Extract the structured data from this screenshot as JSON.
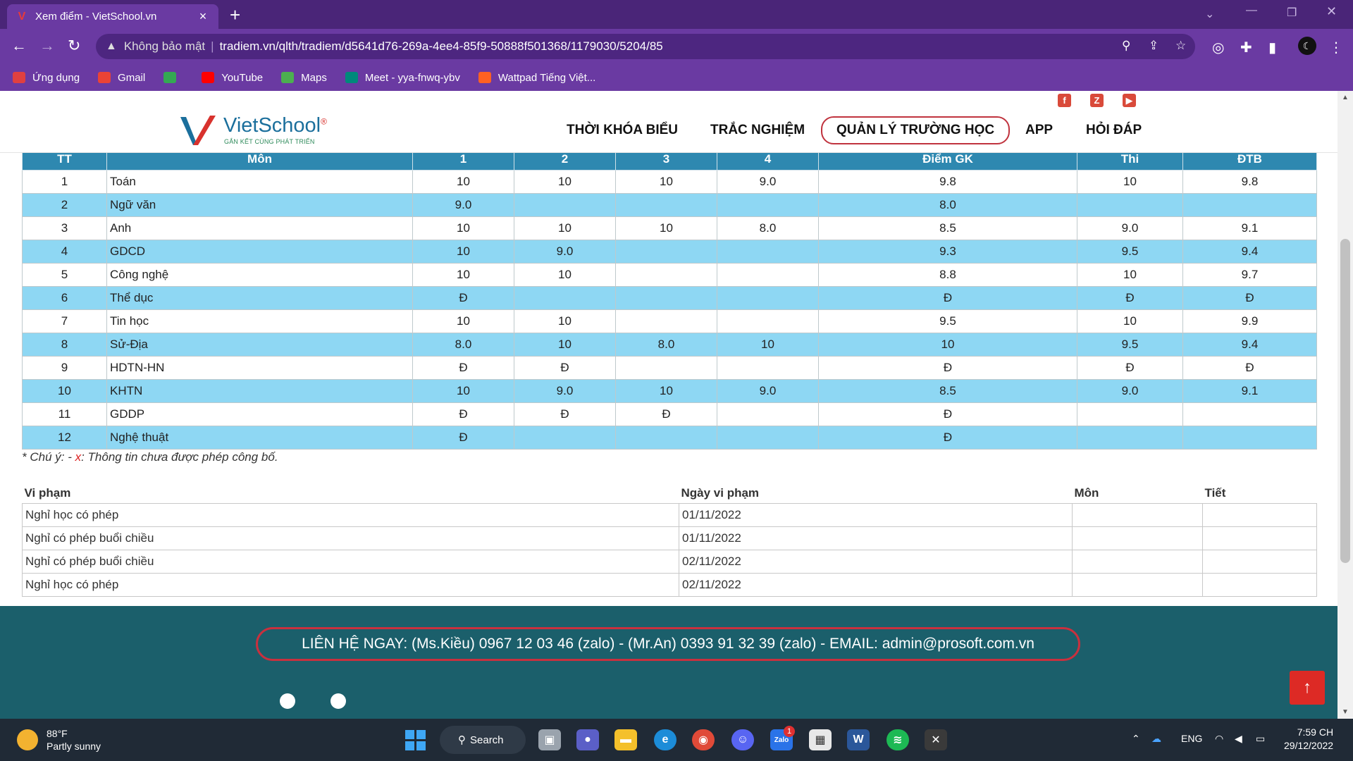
{
  "browser": {
    "tab_title": "Xem điểm - VietSchool.vn",
    "security_label": "Không bảo mật",
    "url": "tradiem.vn/qlth/tradiem/d5641d76-269a-4ee4-85f9-50888f501368/1179030/5204/85",
    "bookmarks": [
      {
        "label": "Ứng dụng",
        "color": "#e04040"
      },
      {
        "label": "Gmail",
        "color": "#ea4335"
      },
      {
        "label": "",
        "color": "#34a853"
      },
      {
        "label": "YouTube",
        "color": "#ff0000"
      },
      {
        "label": "Maps",
        "color": "#4caf50"
      },
      {
        "label": "Meet - yya-fnwq-ybv",
        "color": "#00897b"
      },
      {
        "label": "Wattpad Tiếng Việt...",
        "color": "#ff6122"
      }
    ]
  },
  "header": {
    "logo_text": "VietSchool",
    "logo_mark": "®",
    "logo_tagline": "GẮN KẾT CÙNG PHÁT TRIỂN",
    "menu": [
      {
        "label": "THỜI KHÓA BIỂU"
      },
      {
        "label": "TRẮC NGHIỆM"
      },
      {
        "label": "QUẢN LÝ TRƯỜNG HỌC"
      },
      {
        "label": "APP"
      },
      {
        "label": "HỎI ĐÁP"
      }
    ]
  },
  "grades": {
    "columns": [
      "TT",
      "Môn",
      "1",
      "2",
      "3",
      "4",
      "Điểm GK",
      "Thi",
      "ĐTB"
    ],
    "rows": [
      {
        "tt": "1",
        "subject": "Toán",
        "s1": "10",
        "s2": "10",
        "s3": "10",
        "s4": "9.0",
        "gk": "9.8",
        "thi": "10",
        "dtb": "9.8"
      },
      {
        "tt": "2",
        "subject": "Ngữ văn",
        "s1": "9.0",
        "s2": "",
        "s3": "",
        "s4": "",
        "gk": "8.0",
        "thi": "",
        "dtb": ""
      },
      {
        "tt": "3",
        "subject": "Anh",
        "s1": "10",
        "s2": "10",
        "s3": "10",
        "s4": "8.0",
        "gk": "8.5",
        "thi": "9.0",
        "dtb": "9.1"
      },
      {
        "tt": "4",
        "subject": "GDCD",
        "s1": "10",
        "s2": "9.0",
        "s3": "",
        "s4": "",
        "gk": "9.3",
        "thi": "9.5",
        "dtb": "9.4"
      },
      {
        "tt": "5",
        "subject": "Công nghệ",
        "s1": "10",
        "s2": "10",
        "s3": "",
        "s4": "",
        "gk": "8.8",
        "thi": "10",
        "dtb": "9.7"
      },
      {
        "tt": "6",
        "subject": "Thể dục",
        "s1": "Đ",
        "s2": "",
        "s3": "",
        "s4": "",
        "gk": "Đ",
        "thi": "Đ",
        "dtb": "Đ"
      },
      {
        "tt": "7",
        "subject": "Tin học",
        "s1": "10",
        "s2": "10",
        "s3": "",
        "s4": "",
        "gk": "9.5",
        "thi": "10",
        "dtb": "9.9"
      },
      {
        "tt": "8",
        "subject": "Sử-Địa",
        "s1": "8.0",
        "s2": "10",
        "s3": "8.0",
        "s4": "10",
        "gk": "10",
        "thi": "9.5",
        "dtb": "9.4"
      },
      {
        "tt": "9",
        "subject": "HDTN-HN",
        "s1": "Đ",
        "s2": "Đ",
        "s3": "",
        "s4": "",
        "gk": "Đ",
        "thi": "Đ",
        "dtb": "Đ"
      },
      {
        "tt": "10",
        "subject": "KHTN",
        "s1": "10",
        "s2": "9.0",
        "s3": "10",
        "s4": "9.0",
        "gk": "8.5",
        "thi": "9.0",
        "dtb": "9.1"
      },
      {
        "tt": "11",
        "subject": "GDDP",
        "s1": "Đ",
        "s2": "Đ",
        "s3": "Đ",
        "s4": "",
        "gk": "Đ",
        "thi": "",
        "dtb": ""
      },
      {
        "tt": "12",
        "subject": "Nghệ thuật",
        "s1": "Đ",
        "s2": "",
        "s3": "",
        "s4": "",
        "gk": "Đ",
        "thi": "",
        "dtb": ""
      }
    ]
  },
  "note": {
    "prefix": "* Chú ý: - ",
    "marker": "x",
    "text": ": Thông tin chưa được phép công bố."
  },
  "violations": {
    "columns": [
      "Vi phạm",
      "Ngày vi phạm",
      "Môn",
      "Tiết"
    ],
    "rows": [
      {
        "type": "Nghỉ học có phép",
        "date": "01/11/2022",
        "subject": "",
        "period": ""
      },
      {
        "type": "Nghỉ có phép buổi chiều",
        "date": "01/11/2022",
        "subject": "",
        "period": ""
      },
      {
        "type": "Nghỉ có phép buổi chiều",
        "date": "02/11/2022",
        "subject": "",
        "period": ""
      },
      {
        "type": "Nghỉ học có phép",
        "date": "02/11/2022",
        "subject": "",
        "period": ""
      }
    ]
  },
  "footer": {
    "contact": "LIÊN HỆ NGAY: (Ms.Kiều) 0967 12 03 46 (zalo) - (Mr.An) 0393 91 32 39 (zalo) - EMAIL: admin@prosoft.com.vn"
  },
  "taskbar": {
    "temp": "88°F",
    "weather": "Partly sunny",
    "search_label": "Search",
    "zalo_label": "Zalo",
    "zalo_badge": "1",
    "lang": "ENG",
    "time": "7:59 CH",
    "date": "29/12/2022"
  },
  "colors": {
    "accent": "#6a3aa2",
    "table_header": "#2e88b0",
    "row_alt": "#8ed7f3",
    "footer": "#1b5f6b",
    "brand_red": "#d8322d"
  }
}
